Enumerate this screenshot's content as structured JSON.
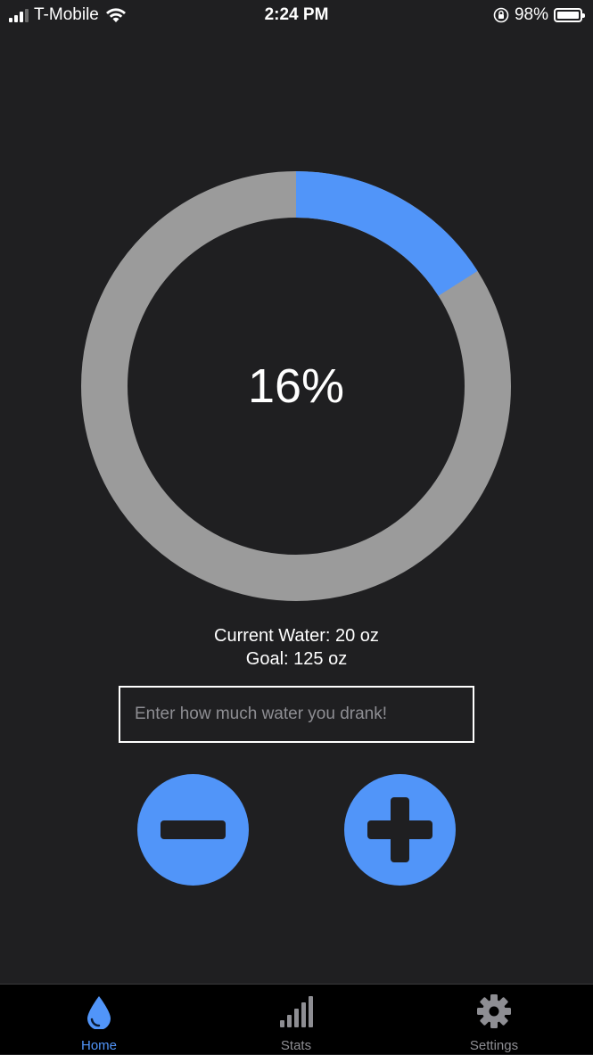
{
  "status_bar": {
    "carrier": "T-Mobile",
    "time": "2:24 PM",
    "battery": "98%",
    "battery_level": 0.98,
    "signal_bars": 3
  },
  "progress": {
    "label": "16%",
    "fraction": 0.16,
    "fill_color": "#5195f9",
    "track_color": "#9b9b9b"
  },
  "info": {
    "current": "Current Water: 20 oz",
    "goal": "Goal: 125 oz"
  },
  "input": {
    "placeholder": "Enter how much water you drank!",
    "value": ""
  },
  "buttons": {
    "minus_icon": "minus-icon",
    "plus_icon": "plus-icon",
    "color": "#5195f9"
  },
  "tab_bar": {
    "active": "Home",
    "tabs": [
      {
        "label": "Home",
        "icon": "water-drop-icon"
      },
      {
        "label": "Stats",
        "icon": "bar-chart-icon"
      },
      {
        "label": "Settings",
        "icon": "gear-icon"
      }
    ]
  }
}
